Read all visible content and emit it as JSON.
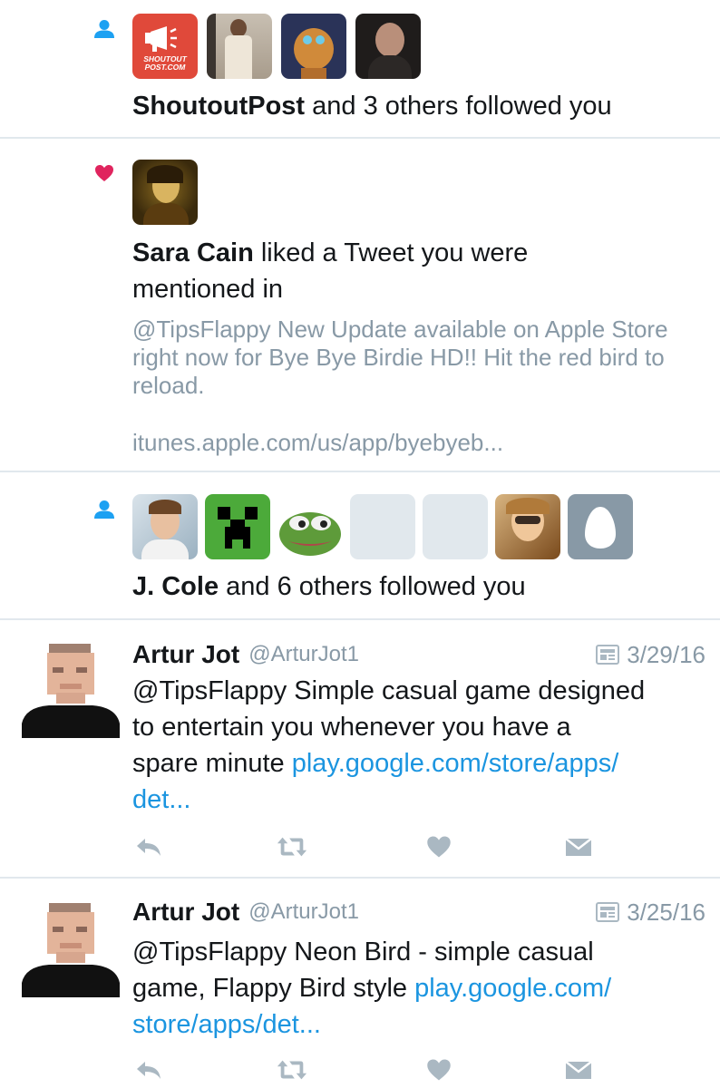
{
  "colors": {
    "follow_icon": "#1da1f2",
    "like_icon": "#e0245e",
    "link": "#1b95e0",
    "muted": "#8899a6",
    "divider": "#e1e8ed",
    "text": "#14171a"
  },
  "notifications": [
    {
      "type": "follow",
      "icon": "person-icon",
      "avatar_labels": [
        "SHOUTOUT",
        "POST.COM"
      ],
      "actor": "ShoutoutPost",
      "rest": " and 3 others followed you"
    },
    {
      "type": "like",
      "icon": "heart-icon",
      "actor": "Sara Cain",
      "rest_line1": " liked a Tweet you were",
      "line2": "mentioned in",
      "quote_lines": [
        "@TipsFlappy New Update available on Apple Store",
        "right now for Bye Bye Birdie HD!! Hit the red bird to",
        "reload."
      ],
      "quote_link": "itunes.apple.com/us/app/byebyeb..."
    },
    {
      "type": "follow",
      "icon": "person-icon",
      "actor": "J. Cole",
      "rest": " and 6 others followed you"
    }
  ],
  "tweets": [
    {
      "name": "Artur Jot",
      "handle": "@ArturJot1",
      "date": "3/29/16",
      "lines": [
        "@TipsFlappy Simple casual game designed",
        "to entertain you whenever you have a"
      ],
      "line3_text": "spare minute ",
      "line3_link": "play.google.com/store/apps/",
      "line4_link": "det..."
    },
    {
      "name": "Artur Jot",
      "handle": "@ArturJot1",
      "date": "3/25/16",
      "line1": "@TipsFlappy Neon Bird - simple casual",
      "line2_text": "game, Flappy Bird style ",
      "line2_link": "play.google.com/",
      "line3_link": "store/apps/det..."
    }
  ]
}
